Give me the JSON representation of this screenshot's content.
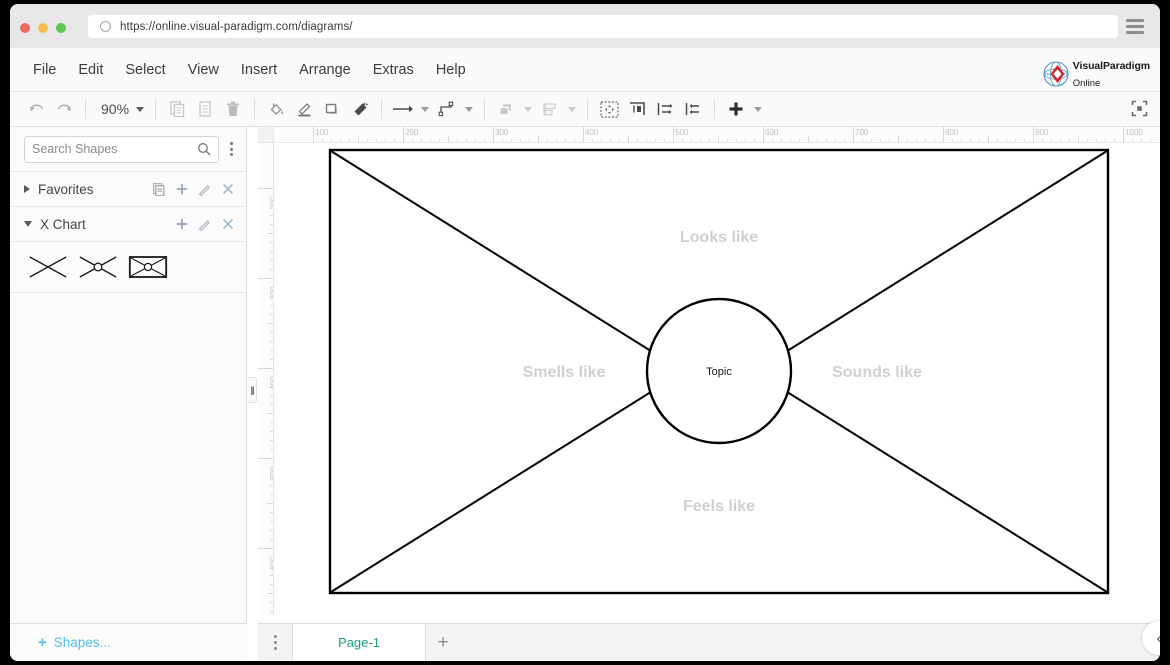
{
  "browser": {
    "url": "https://online.visual-paradigm.com/diagrams/",
    "url_icon": "reload-circle-icon",
    "menu_icon": "hamburger-menu-icon",
    "traffic_lights": [
      "close-red",
      "minimize-yellow",
      "maximize-green"
    ]
  },
  "app": {
    "brand_line1": "VisualParadigm",
    "brand_line2": "Online",
    "brand_icon": "visual-paradigm-globe-logo"
  },
  "menubar": {
    "items": [
      {
        "label": "File"
      },
      {
        "label": "Edit"
      },
      {
        "label": "Select"
      },
      {
        "label": "View"
      },
      {
        "label": "Insert"
      },
      {
        "label": "Arrange"
      },
      {
        "label": "Extras"
      },
      {
        "label": "Help"
      }
    ]
  },
  "toolbar": {
    "zoom_level": "90%",
    "buttons": [
      {
        "name": "undo",
        "icon": "undo-arrow-icon",
        "state": "disabled"
      },
      {
        "name": "redo",
        "icon": "redo-arrow-icon",
        "state": "disabled"
      },
      {
        "name": "zoom-dropdown",
        "icon": "chevron-down-icon",
        "state": "enabled"
      },
      {
        "name": "copy",
        "icon": "copy-icon",
        "state": "disabled"
      },
      {
        "name": "paste",
        "icon": "paste-document-icon",
        "state": "disabled"
      },
      {
        "name": "delete",
        "icon": "trash-icon",
        "state": "disabled"
      },
      {
        "name": "fill-color",
        "icon": "paint-bucket-icon",
        "state": "enabled"
      },
      {
        "name": "line-color",
        "icon": "pencil-line-icon",
        "state": "enabled"
      },
      {
        "name": "shadow",
        "icon": "square-shadow-icon",
        "state": "enabled"
      },
      {
        "name": "format-painter",
        "icon": "paint-brush-icon",
        "state": "enabled"
      },
      {
        "name": "connection-style",
        "icon": "straight-arrow-icon",
        "state": "enabled"
      },
      {
        "name": "waypoints",
        "icon": "orthogonal-connector-icon",
        "state": "enabled"
      },
      {
        "name": "arrange-order",
        "icon": "bring-to-front-icon",
        "state": "disabled"
      },
      {
        "name": "distribute",
        "icon": "align-objects-icon",
        "state": "disabled"
      },
      {
        "name": "fit-page",
        "icon": "fit-selection-icon",
        "state": "enabled"
      },
      {
        "name": "insert-page-break",
        "icon": "insert-column-icon",
        "state": "enabled"
      },
      {
        "name": "distribute-horizontal",
        "icon": "distribute-horizontal-icon",
        "state": "enabled"
      },
      {
        "name": "distribute-vertical",
        "icon": "distribute-vertical-icon",
        "state": "enabled"
      },
      {
        "name": "insert",
        "icon": "plus-icon",
        "state": "enabled"
      },
      {
        "name": "insert-dropdown",
        "icon": "chevron-down-icon",
        "state": "enabled"
      },
      {
        "name": "fullscreen",
        "icon": "fullscreen-expand-icon",
        "state": "enabled"
      }
    ]
  },
  "sidebar": {
    "search": {
      "placeholder": "Search Shapes",
      "value": "",
      "icon": "search-icon"
    },
    "options_icon": "kebab-menu-icon",
    "groups": [
      {
        "label": "Favorites",
        "expanded": false,
        "chevron": "chevron-right-icon",
        "actions": [
          "copy-page-icon",
          "plus-icon",
          "pencil-icon",
          "close-x-icon"
        ]
      },
      {
        "label": "X Chart",
        "expanded": true,
        "chevron": "chevron-down-icon",
        "actions": [
          "plus-icon",
          "pencil-icon",
          "close-x-icon"
        ]
      }
    ],
    "shape_thumbnails": [
      {
        "name": "x-cross-shape"
      },
      {
        "name": "x-cross-with-circle-shape"
      },
      {
        "name": "x-chart-boxed-shape"
      }
    ],
    "footer": {
      "label": "Shapes...",
      "icon": "plus-icon"
    }
  },
  "canvas": {
    "ruler_h_labels": [
      "100",
      "200",
      "300",
      "400",
      "500",
      "600",
      "700",
      "800",
      "900",
      "1000"
    ],
    "ruler_v_labels": [
      "200",
      "300",
      "400",
      "500",
      "600"
    ],
    "diagram": {
      "type": "x-chart",
      "center_label": "Topic",
      "quadrant_labels": {
        "top": "Looks like",
        "left": "Smells like",
        "right": "Sounds like",
        "bottom": "Feels like"
      },
      "label_color": "#cfcfcf",
      "center_text_color": "#1a1a1a",
      "stroke_color": "#000000"
    }
  },
  "bottombar": {
    "pages_menu_icon": "kebab-menu-icon",
    "tabs": [
      {
        "label": "Page-1",
        "active": true
      }
    ],
    "add_page_icon": "plus-icon",
    "collapse_icon": "chevron-left-icon"
  },
  "colors": {
    "accent_blue": "#4fbfe8",
    "page_tab_text": "#1a9e7e",
    "toolbar_bg": "#fafafa",
    "canvas_bg": "#ffffff"
  }
}
